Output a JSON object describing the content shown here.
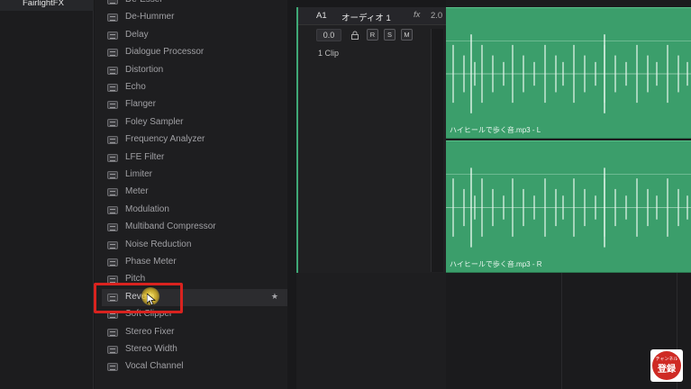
{
  "left_panel": {
    "category": "FairlightFX"
  },
  "fx_list": [
    {
      "label": "De-Esser"
    },
    {
      "label": "De-Hummer"
    },
    {
      "label": "Delay"
    },
    {
      "label": "Dialogue Processor"
    },
    {
      "label": "Distortion"
    },
    {
      "label": "Echo"
    },
    {
      "label": "Flanger"
    },
    {
      "label": "Foley Sampler"
    },
    {
      "label": "Frequency Analyzer"
    },
    {
      "label": "LFE Filter"
    },
    {
      "label": "Limiter"
    },
    {
      "label": "Meter"
    },
    {
      "label": "Modulation"
    },
    {
      "label": "Multiband Compressor"
    },
    {
      "label": "Noise Reduction"
    },
    {
      "label": "Phase Meter"
    },
    {
      "label": "Pitch"
    },
    {
      "label": "Reverb",
      "selected": true,
      "favorite": "★"
    },
    {
      "label": "Soft Clipper"
    },
    {
      "label": "Stereo Fixer"
    },
    {
      "label": "Stereo Width"
    },
    {
      "label": "Vocal Channel"
    }
  ],
  "track": {
    "id": "A1",
    "name": "オーディオ 1",
    "fx_label": "fx",
    "channels": "2.0",
    "volume": "0.0",
    "btn_r": "R",
    "btn_s": "S",
    "btn_m": "M",
    "clip_count": "1 Clip"
  },
  "clips": {
    "left_name": "ハイヒールで歩く音.mp3 - L",
    "right_name": "ハイヒールで歩く音.mp3 - R"
  },
  "subscribe": {
    "small": "チャンネル",
    "text": "登録"
  },
  "colors": {
    "clip_green": "#3b9e6b",
    "highlight_red": "#d9231f",
    "accent": "#3fa876"
  }
}
